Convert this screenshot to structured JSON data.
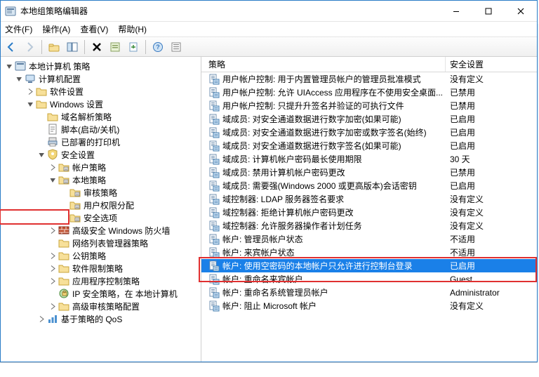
{
  "window": {
    "title": "本地组策略编辑器"
  },
  "menu": {
    "file": "文件(F)",
    "action": "操作(A)",
    "view": "查看(V)",
    "help": "帮助(H)"
  },
  "columns": {
    "policy": "策略",
    "setting": "安全设置"
  },
  "tree": [
    {
      "l": 0,
      "t": "root",
      "exp": true,
      "label": "本地计算机 策略",
      "icon": "gp"
    },
    {
      "l": 1,
      "t": "node",
      "exp": true,
      "label": "计算机配置",
      "icon": "pc"
    },
    {
      "l": 2,
      "t": "node",
      "exp": false,
      "label": "软件设置",
      "icon": "folder",
      "twisty": ">"
    },
    {
      "l": 2,
      "t": "node",
      "exp": true,
      "label": "Windows 设置",
      "icon": "folder"
    },
    {
      "l": 3,
      "t": "leaf",
      "label": "域名解析策略",
      "icon": "folder"
    },
    {
      "l": 3,
      "t": "leaf",
      "label": "脚本(启动/关机)",
      "icon": "script"
    },
    {
      "l": 3,
      "t": "leaf",
      "label": "已部署的打印机",
      "icon": "printer"
    },
    {
      "l": 3,
      "t": "node",
      "exp": true,
      "label": "安全设置",
      "icon": "shield"
    },
    {
      "l": 4,
      "t": "node",
      "exp": false,
      "label": "帐户策略",
      "icon": "folderp",
      "twisty": ">"
    },
    {
      "l": 4,
      "t": "node",
      "exp": true,
      "label": "本地策略",
      "icon": "folderp"
    },
    {
      "l": 5,
      "t": "leaf",
      "label": "审核策略",
      "icon": "folderp"
    },
    {
      "l": 5,
      "t": "leaf",
      "label": "用户权限分配",
      "icon": "folderp"
    },
    {
      "l": 5,
      "t": "leaf",
      "label": "安全选项",
      "icon": "folderp",
      "hi": true
    },
    {
      "l": 4,
      "t": "leaf",
      "label": "高级安全 Windows 防火墙",
      "icon": "firewall",
      "twisty": ">"
    },
    {
      "l": 4,
      "t": "leaf",
      "label": "网络列表管理器策略",
      "icon": "folder"
    },
    {
      "l": 4,
      "t": "leaf",
      "label": "公钥策略",
      "icon": "folder",
      "twisty": ">"
    },
    {
      "l": 4,
      "t": "leaf",
      "label": "软件限制策略",
      "icon": "folder",
      "twisty": ">"
    },
    {
      "l": 4,
      "t": "leaf",
      "label": "应用程序控制策略",
      "icon": "folder",
      "twisty": ">"
    },
    {
      "l": 4,
      "t": "leaf",
      "label": "IP 安全策略，在 本地计算机",
      "icon": "ipsec"
    },
    {
      "l": 4,
      "t": "leaf",
      "label": "高级审核策略配置",
      "icon": "folder",
      "twisty": ">"
    },
    {
      "l": 3,
      "t": "leaf",
      "label": "基于策略的 QoS",
      "icon": "qos",
      "twisty": ">"
    }
  ],
  "policies": [
    {
      "name": "用户帐户控制: 用于内置管理员帐户的管理员批准模式",
      "value": "没有定义"
    },
    {
      "name": "用户帐户控制: 允许 UIAccess 应用程序在不使用安全桌面...",
      "value": "已禁用"
    },
    {
      "name": "用户帐户控制: 只提升升签名并验证的可执行文件",
      "value": "已禁用"
    },
    {
      "name": "域成员: 对安全通道数据进行数字加密(如果可能)",
      "value": "已启用"
    },
    {
      "name": "域成员: 对安全通道数据进行数字加密或数字签名(始终)",
      "value": "已启用"
    },
    {
      "name": "域成员: 对安全通道数据进行数字签名(如果可能)",
      "value": "已启用"
    },
    {
      "name": "域成员: 计算机帐户密码最长使用期限",
      "value": "30 天"
    },
    {
      "name": "域成员: 禁用计算机帐户密码更改",
      "value": "已禁用"
    },
    {
      "name": "域成员: 需要强(Windows 2000 或更高版本)会话密钥",
      "value": "已启用"
    },
    {
      "name": "域控制器: LDAP 服务器签名要求",
      "value": "没有定义"
    },
    {
      "name": "域控制器: 拒绝计算机帐户密码更改",
      "value": "没有定义"
    },
    {
      "name": "域控制器: 允许服务器操作者计划任务",
      "value": "没有定义"
    },
    {
      "name": "帐户: 管理员帐户状态",
      "value": "不适用"
    },
    {
      "name": "帐户: 来宾帐户状态",
      "value": "不适用"
    },
    {
      "name": "帐户: 使用空密码的本地帐户只允许进行控制台登录",
      "value": "已启用",
      "sel": true,
      "hi": true
    },
    {
      "name": "帐户: 重命名来宾帐户",
      "value": "Guest"
    },
    {
      "name": "帐户: 重命名系统管理员帐户",
      "value": "Administrator"
    },
    {
      "name": "帐户: 阻止 Microsoft 帐户",
      "value": "没有定义"
    }
  ]
}
